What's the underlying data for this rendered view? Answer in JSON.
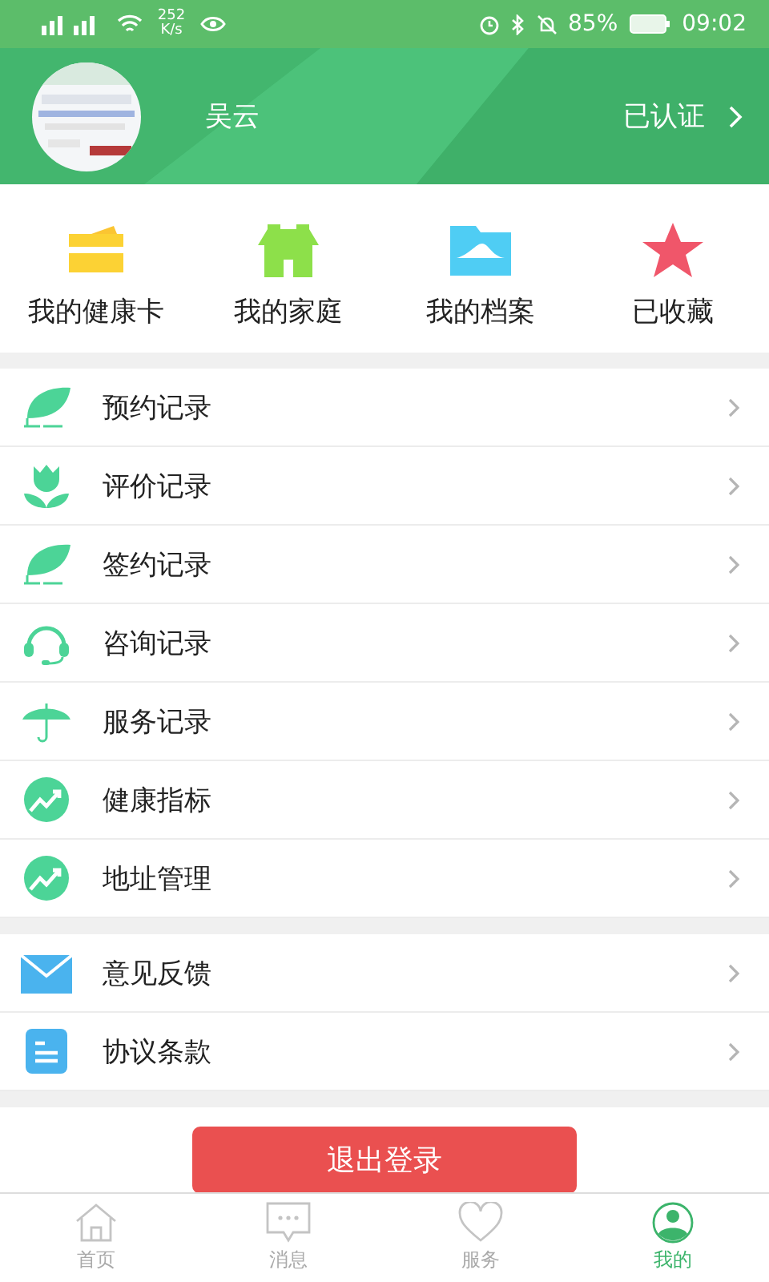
{
  "status_bar": {
    "speed": "252 K/s",
    "battery": "85%",
    "time": "09:02"
  },
  "profile": {
    "name": "吴云",
    "verified": "已认证"
  },
  "shortcuts": [
    "我的健康卡",
    "我的家庭",
    "我的档案",
    "已收藏"
  ],
  "menu_groups": [
    [
      "预约记录",
      "评价记录",
      "签约记录",
      "咨询记录",
      "服务记录",
      "健康指标",
      "地址管理"
    ],
    [
      "意见反馈",
      "协议条款"
    ]
  ],
  "logout_button": "退出登录",
  "tab_bar": [
    {
      "label": "首页",
      "selected": false
    },
    {
      "label": "消息",
      "selected": false
    },
    {
      "label": "服务",
      "selected": false
    },
    {
      "label": "我的",
      "selected": true
    }
  ]
}
